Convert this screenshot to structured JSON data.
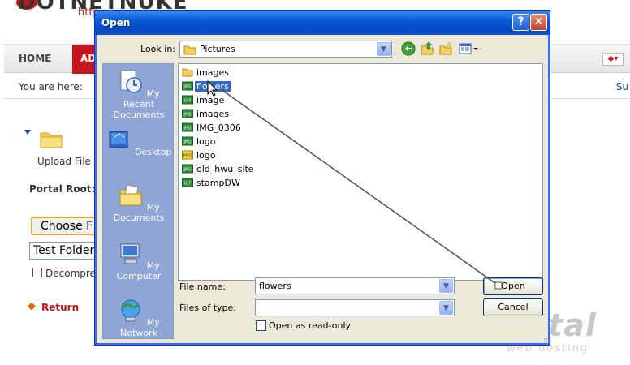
{
  "background": {
    "logo": "DOTNETNUKE",
    "logo_url": "http",
    "nav": {
      "home": "HOME",
      "admin": "AD"
    },
    "breadcrumb_label": "You are here:",
    "breadcrumb_right": "Su",
    "upload_label": "Upload File",
    "portal_root_label": "Portal Root:",
    "choose_button": "Choose F",
    "folder_value": "Test Folder",
    "decompress_label": "Decompre",
    "return_label": "Return",
    "watermark_big": "portal",
    "watermark_small": "web hosting"
  },
  "dialog": {
    "title": "Open",
    "help_button": "?",
    "close_button": "✕",
    "look_in_label": "Look in:",
    "look_in_value": "Pictures",
    "places": [
      {
        "label": "My Recent Documents",
        "icon": "recent-documents-icon"
      },
      {
        "label": "Desktop",
        "icon": "desktop-icon"
      },
      {
        "label": "My Documents",
        "icon": "my-documents-icon"
      },
      {
        "label": "My Computer",
        "icon": "my-computer-icon"
      },
      {
        "label": "My Network",
        "icon": "my-network-icon"
      }
    ],
    "files": [
      {
        "name": "images",
        "type": "folder",
        "badge": ""
      },
      {
        "name": "flowers",
        "type": "jpg",
        "badge": "JPG",
        "selected": true
      },
      {
        "name": "image",
        "type": "gif",
        "badge": "GIF"
      },
      {
        "name": "images",
        "type": "jpg",
        "badge": "JPG"
      },
      {
        "name": "IMG_0306",
        "type": "jpg",
        "badge": "JPG"
      },
      {
        "name": "logo",
        "type": "jpg",
        "badge": "JPG"
      },
      {
        "name": "logo",
        "type": "psd",
        "badge": "PSD"
      },
      {
        "name": "old_hwu_site",
        "type": "jpg",
        "badge": "JPG"
      },
      {
        "name": "stampDW",
        "type": "gif",
        "badge": "GIF"
      }
    ],
    "file_name_label": "File name:",
    "file_name_value": "flowers",
    "files_of_type_label": "Files of type:",
    "files_of_type_value": "",
    "read_only_label": "Open as read-only",
    "open_button": "Open",
    "cancel_button": "Cancel"
  },
  "colors": {
    "dialog_bg": "#ece9d8",
    "title_bar": "#0a5bd6",
    "selection": "#316ac5",
    "places_bar": "#8ea5d6",
    "brand_red": "#c8151b"
  }
}
